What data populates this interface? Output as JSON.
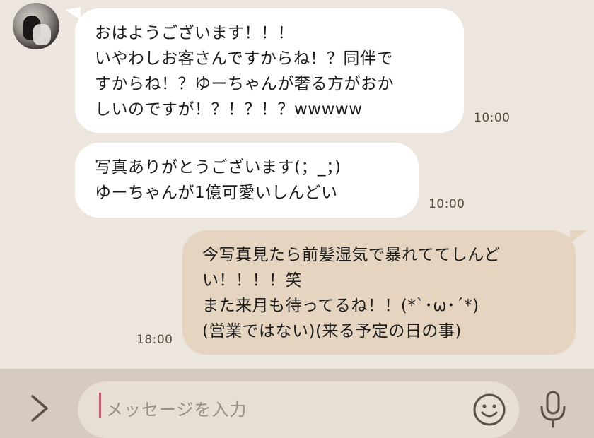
{
  "messages": [
    {
      "sender": "other",
      "lines": [
        "おはようございます！！！",
        "いやわしお客さんですからね！？同伴で",
        "すからね！？ゆーちゃんが奢る方がおか",
        "しいのですが！？！？！？wwwww"
      ],
      "time": "10:00"
    },
    {
      "sender": "other",
      "lines": [
        "写真ありがとうございます(；_；)",
        "ゆーちゃんが1億可愛いしんどい"
      ],
      "time": "10:00"
    },
    {
      "sender": "me",
      "lines": [
        "今写真見たら前髪湿気で暴れててしんど",
        "い！！！！笑",
        "また来月も待ってるね！！(*`･ω･´*)",
        "(営業ではない)(来る予定の日の事)"
      ],
      "time": "18:00"
    }
  ],
  "input": {
    "placeholder": "メッセージを入力"
  },
  "icons": {
    "expand": "chevron-right-icon",
    "emoji": "smiley-icon",
    "mic": "microphone-icon"
  },
  "colors": {
    "background": "#ece6de",
    "incoming_bubble": "#ffffff",
    "outgoing_bubble": "#e5d5c0",
    "input_bar": "#d6cbbe"
  }
}
